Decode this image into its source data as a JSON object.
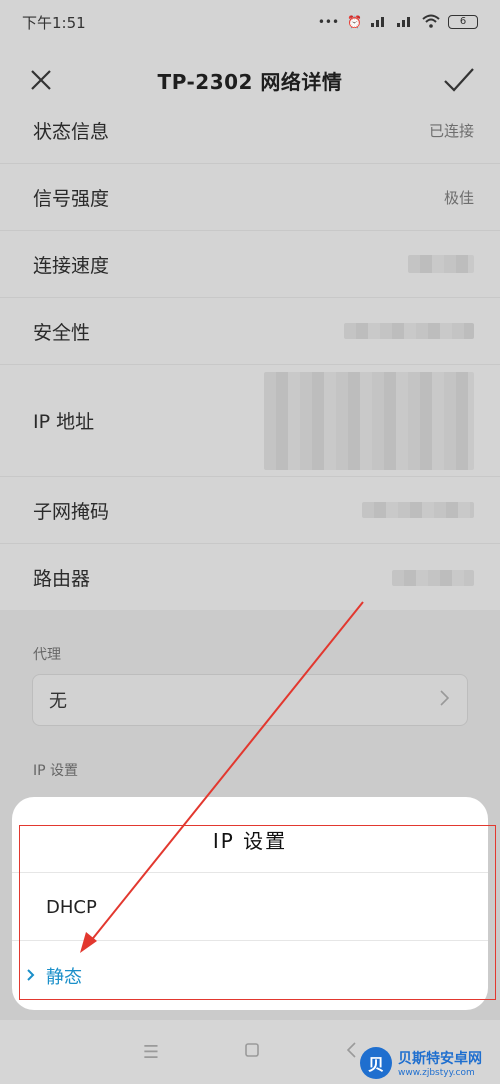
{
  "status": {
    "time": "下午1:51",
    "battery": "6"
  },
  "header": {
    "title": "TP-2302 网络详情"
  },
  "rows": [
    {
      "label": "状态信息",
      "value": "已连接"
    },
    {
      "label": "信号强度",
      "value": "极佳"
    },
    {
      "label": "连接速度",
      "value": ""
    },
    {
      "label": "安全性",
      "value": ""
    },
    {
      "label": "IP 地址",
      "value": ""
    },
    {
      "label": "子网掩码",
      "value": ""
    },
    {
      "label": "路由器",
      "value": ""
    }
  ],
  "proxy": {
    "label": "代理",
    "value": "无"
  },
  "ip_settings": {
    "label": "IP 设置"
  },
  "sheet": {
    "title": "IP 设置",
    "options": [
      {
        "label": "DHCP"
      },
      {
        "label": "静态"
      }
    ]
  },
  "watermark": {
    "name": "贝斯特安卓网",
    "url": "www.zjbstyy.com",
    "logo_glyph": "贝"
  },
  "colors": {
    "accent": "#1a8fc9",
    "annotation": "#e2382f"
  }
}
